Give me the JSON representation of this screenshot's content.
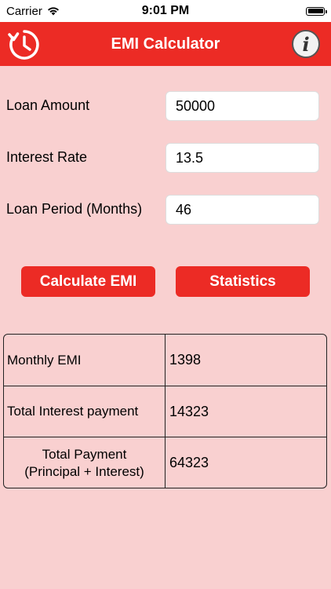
{
  "status_bar": {
    "carrier": "Carrier",
    "time": "9:01 PM"
  },
  "navbar": {
    "title": "EMI Calculator",
    "history_icon": "history-clock-icon",
    "info_icon": "info-icon",
    "info_glyph": "i"
  },
  "form": {
    "loan_amount": {
      "label": "Loan Amount",
      "value": "50000"
    },
    "interest_rate": {
      "label": "Interest Rate",
      "value": "13.5"
    },
    "loan_period": {
      "label": "Loan Period (Months)",
      "value": "46"
    }
  },
  "buttons": {
    "calculate": "Calculate EMI",
    "statistics": "Statistics"
  },
  "results": {
    "monthly_emi": {
      "label": "Monthly EMI",
      "value": "1398"
    },
    "total_interest": {
      "label": "Total Interest payment",
      "value": "14323"
    },
    "total_payment": {
      "label_line1": "Total Payment",
      "label_line2": "(Principal + Interest)",
      "value": "64323"
    }
  },
  "colors": {
    "accent": "#ec2b25",
    "background": "#f9d0d0"
  }
}
